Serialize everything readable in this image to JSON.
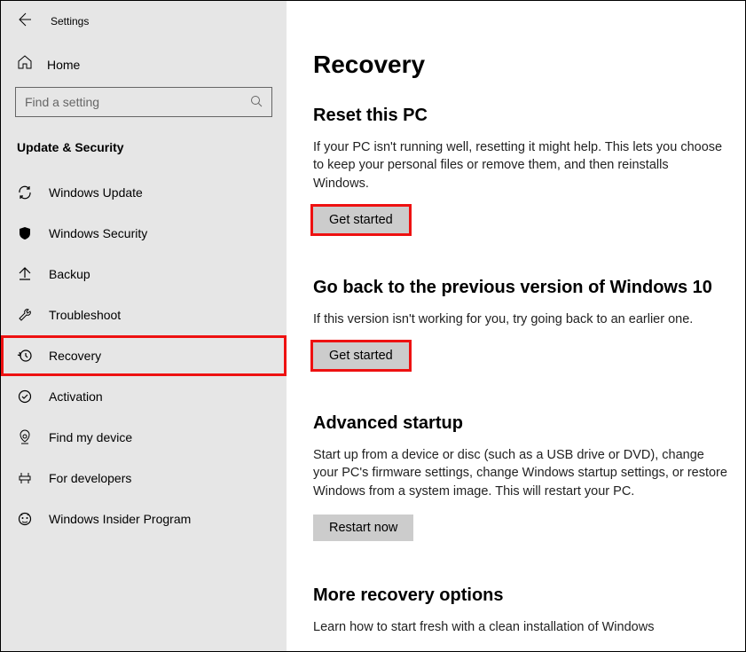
{
  "app_title": "Settings",
  "home_label": "Home",
  "search_placeholder": "Find a setting",
  "category": "Update & Security",
  "nav": [
    {
      "label": "Windows Update",
      "icon": "sync"
    },
    {
      "label": "Windows Security",
      "icon": "shield"
    },
    {
      "label": "Backup",
      "icon": "backup"
    },
    {
      "label": "Troubleshoot",
      "icon": "wrench"
    },
    {
      "label": "Recovery",
      "icon": "history",
      "highlighted": true
    },
    {
      "label": "Activation",
      "icon": "check-circle"
    },
    {
      "label": "Find my device",
      "icon": "location"
    },
    {
      "label": "For developers",
      "icon": "devtools"
    },
    {
      "label": "Windows Insider Program",
      "icon": "insider"
    }
  ],
  "page_title": "Recovery",
  "sections": {
    "reset": {
      "heading": "Reset this PC",
      "body": "If your PC isn't running well, resetting it might help. This lets you choose to keep your personal files or remove them, and then reinstalls Windows.",
      "button": "Get started"
    },
    "goback": {
      "heading": "Go back to the previous version of Windows 10",
      "body": "If this version isn't working for you, try going back to an earlier one.",
      "button": "Get started"
    },
    "advanced": {
      "heading": "Advanced startup",
      "body": "Start up from a device or disc (such as a USB drive or DVD), change your PC's firmware settings, change Windows startup settings, or restore Windows from a system image. This will restart your PC.",
      "button": "Restart now"
    },
    "more": {
      "heading": "More recovery options",
      "link": "Learn how to start fresh with a clean installation of Windows"
    }
  }
}
